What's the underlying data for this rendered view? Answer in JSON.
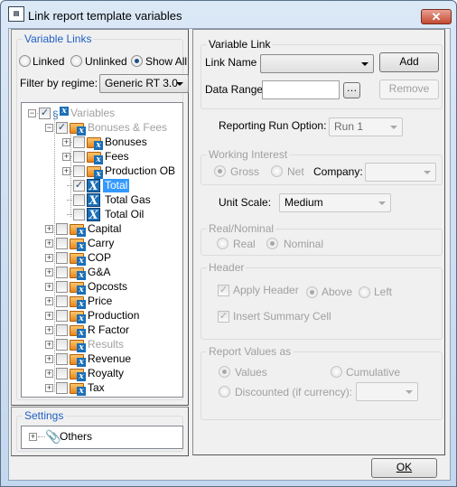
{
  "window": {
    "title": "Link report template variables",
    "close_label": "✕"
  },
  "variable_links": {
    "label": "Variable Links",
    "radios": [
      {
        "label": "Linked",
        "checked": false
      },
      {
        "label": "Unlinked",
        "checked": false
      },
      {
        "label": "Show All",
        "checked": true
      }
    ],
    "filter_label": "Filter by regime:",
    "filter_value": "Generic RT 3.0"
  },
  "tree": [
    {
      "label": "Variables",
      "level": 0,
      "expander": "−",
      "checked": true,
      "icon": "variables-icon",
      "disabled": true
    },
    {
      "label": "Bonuses & Fees",
      "level": 1,
      "expander": "−",
      "checked": true,
      "icon": "folder-icon",
      "disabled": true
    },
    {
      "label": "Bonuses",
      "level": 2,
      "expander": "+",
      "checked": false,
      "icon": "folder-icon"
    },
    {
      "label": "Fees",
      "level": 2,
      "expander": "+",
      "checked": false,
      "icon": "folder-icon"
    },
    {
      "label": "Production OB",
      "level": 2,
      "expander": "+",
      "checked": false,
      "icon": "folder-icon"
    },
    {
      "label": "Total",
      "level": 2,
      "expander": "",
      "checked": true,
      "icon": "variable-icon",
      "selected": true
    },
    {
      "label": "Total Gas",
      "level": 2,
      "expander": "",
      "checked": false,
      "icon": "variable-icon"
    },
    {
      "label": "Total Oil",
      "level": 2,
      "expander": "",
      "checked": false,
      "icon": "variable-icon"
    },
    {
      "label": "Capital",
      "level": 1,
      "expander": "+",
      "checked": false,
      "icon": "folder-icon"
    },
    {
      "label": "Carry",
      "level": 1,
      "expander": "+",
      "checked": false,
      "icon": "folder-icon"
    },
    {
      "label": "COP",
      "level": 1,
      "expander": "+",
      "checked": false,
      "icon": "folder-icon"
    },
    {
      "label": "G&A",
      "level": 1,
      "expander": "+",
      "checked": false,
      "icon": "folder-icon"
    },
    {
      "label": "Opcosts",
      "level": 1,
      "expander": "+",
      "checked": false,
      "icon": "folder-icon"
    },
    {
      "label": "Price",
      "level": 1,
      "expander": "+",
      "checked": false,
      "icon": "folder-icon"
    },
    {
      "label": "Production",
      "level": 1,
      "expander": "+",
      "checked": false,
      "icon": "folder-icon"
    },
    {
      "label": "R Factor",
      "level": 1,
      "expander": "+",
      "checked": false,
      "icon": "folder-icon"
    },
    {
      "label": "Results",
      "level": 1,
      "expander": "+",
      "checked": false,
      "icon": "folder-icon",
      "disabled": true
    },
    {
      "label": "Revenue",
      "level": 1,
      "expander": "+",
      "checked": false,
      "icon": "folder-icon"
    },
    {
      "label": "Royalty",
      "level": 1,
      "expander": "+",
      "checked": false,
      "icon": "folder-icon"
    },
    {
      "label": "Tax",
      "level": 1,
      "expander": "+",
      "checked": false,
      "icon": "folder-icon"
    }
  ],
  "settings": {
    "label": "Settings",
    "item": "Others",
    "expander": "+"
  },
  "variable_link": {
    "label": "Variable Link",
    "link_name_label": "Link Name",
    "link_name_value": "",
    "add_label": "Add",
    "data_range_label": "Data Range",
    "data_range_value": "",
    "browse_label": "…",
    "remove_label": "Remove"
  },
  "reporting_run": {
    "label": "Reporting Run Option:",
    "value": "Run 1"
  },
  "working_interest": {
    "label": "Working Interest",
    "gross": "Gross",
    "net": "Net",
    "selected": "Gross",
    "company_label": "Company:",
    "company_value": ""
  },
  "unit_scale": {
    "label": "Unit Scale:",
    "value": "Medium"
  },
  "real_nominal": {
    "label": "Real/Nominal",
    "real": "Real",
    "nominal": "Nominal",
    "selected": "Nominal"
  },
  "header": {
    "label": "Header",
    "apply_header": "Apply Header",
    "apply_checked": true,
    "above": "Above",
    "left": "Left",
    "selected": "Above",
    "insert_summary": "Insert Summary Cell",
    "insert_checked": true
  },
  "report_values": {
    "label": "Report Values as",
    "values": "Values",
    "cumulative": "Cumulative",
    "discounted": "Discounted (if currency):",
    "selected": "Values",
    "discount_value": ""
  },
  "ok_label": "OK",
  "colors": {
    "selection": "#3399ff",
    "group_label": "#1f5fc4",
    "frame": "#c3d7ee",
    "close": "#c44a32"
  }
}
